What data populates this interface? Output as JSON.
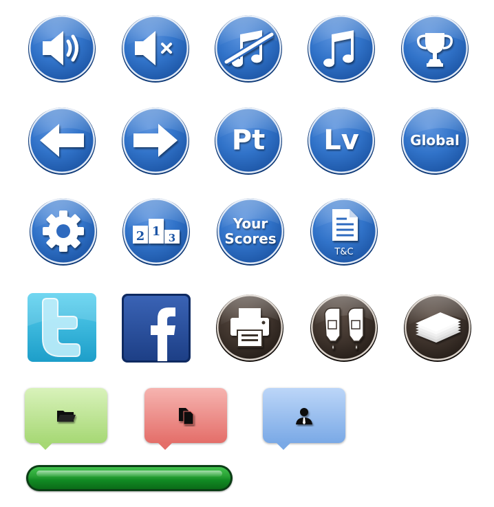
{
  "labels": {
    "points": "Pt",
    "level": "Lv",
    "global": "Global",
    "your_scores_line1": "Your",
    "your_scores_line2": "Scores",
    "terms": "T&C",
    "podium_2": "2",
    "podium_1": "1",
    "podium_3": "3"
  },
  "colors": {
    "blue_button": "#2f6bbf",
    "brown_button": "#3b302a",
    "twitter": "#33b9df",
    "facebook": "#254c9a",
    "green_tooltip": "#b6de8a",
    "red_tooltip": "#ea7b76",
    "blue_tooltip": "#84b2ea",
    "progress_fill": "#1f9a2e"
  },
  "icons": [
    "speaker-on-icon",
    "speaker-mute-icon",
    "music-off-icon",
    "music-on-icon",
    "trophy-icon",
    "arrow-left-icon",
    "arrow-right-icon",
    "gear-icon",
    "podium-icon",
    "document-icon",
    "twitter-bird-icon",
    "facebook-icon",
    "printer-icon",
    "ink-cartridges-icon",
    "paper-stack-icon",
    "folder-icon",
    "copy-icon",
    "user-icon"
  ],
  "progress": {
    "value": 1.0
  }
}
